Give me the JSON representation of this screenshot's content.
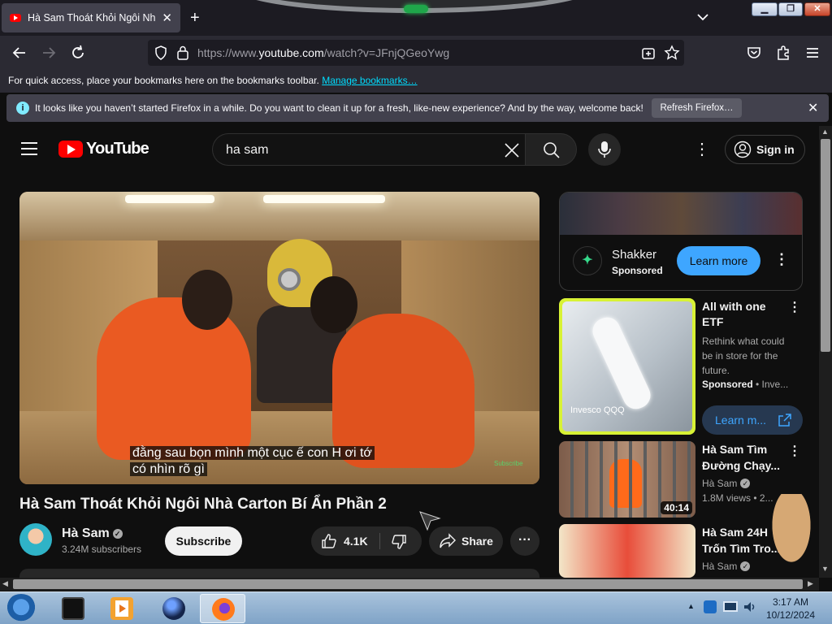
{
  "browser": {
    "tab_title": "Hà Sam Thoát Khỏi Ngôi Nhà C",
    "url_prefix": "https://www.",
    "url_domain": "youtube.com",
    "url_path": "/watch?v=JFnjQGeoYwg",
    "bookmarks_text": "For quick access, place your bookmarks here on the bookmarks toolbar.",
    "bookmarks_link": "Manage bookmarks…",
    "notification_text": "It looks like you haven’t started Firefox in a while. Do you want to clean it up for a fresh, like-new experience? And by the way, welcome back!",
    "refresh_button": "Refresh Firefox…"
  },
  "youtube": {
    "logo_text": "YouTube",
    "search_query": "ha sam",
    "sign_in": "Sign in"
  },
  "video": {
    "subtitle_line1": "đằng sau bọn mình một cục ế con H ơi tớ",
    "subtitle_line2": "có nhìn rõ gì",
    "watermark": "Subscribe",
    "title": "Hà Sam Thoát Khỏi Ngôi Nhà Carton Bí Ẩn Phần 2",
    "channel": "Hà Sam",
    "subscribers": "3.24M subscribers",
    "subscribe_label": "Subscribe",
    "likes": "4.1K",
    "share_label": "Share"
  },
  "sidebar": {
    "ad": {
      "name": "Shakker",
      "sponsored": "Sponsored",
      "learn_more": "Learn more"
    },
    "etf": {
      "title": "All with one ETF",
      "description": "Rethink what could be in store for the future.",
      "sponsored": "Sponsored",
      "advertiser": "Inve...",
      "learn_more": "Learn m...",
      "thumb_badge": "Invesco QQQ"
    },
    "recs": [
      {
        "title": "Hà Sam Tìm Đường Chạy...",
        "channel": "Hà Sam",
        "meta": "1.8M views • 2...",
        "duration": "40:14"
      },
      {
        "title": "Hà Sam 24H Trốn Tìm Tro...",
        "channel": "Hà Sam"
      }
    ]
  },
  "taskbar": {
    "time": "3:17 AM",
    "date": "10/12/2024"
  },
  "colors": {
    "yt_red": "#ff0000",
    "yt_blue": "#3ea6ff",
    "firefox_dark": "#1c1b22"
  }
}
